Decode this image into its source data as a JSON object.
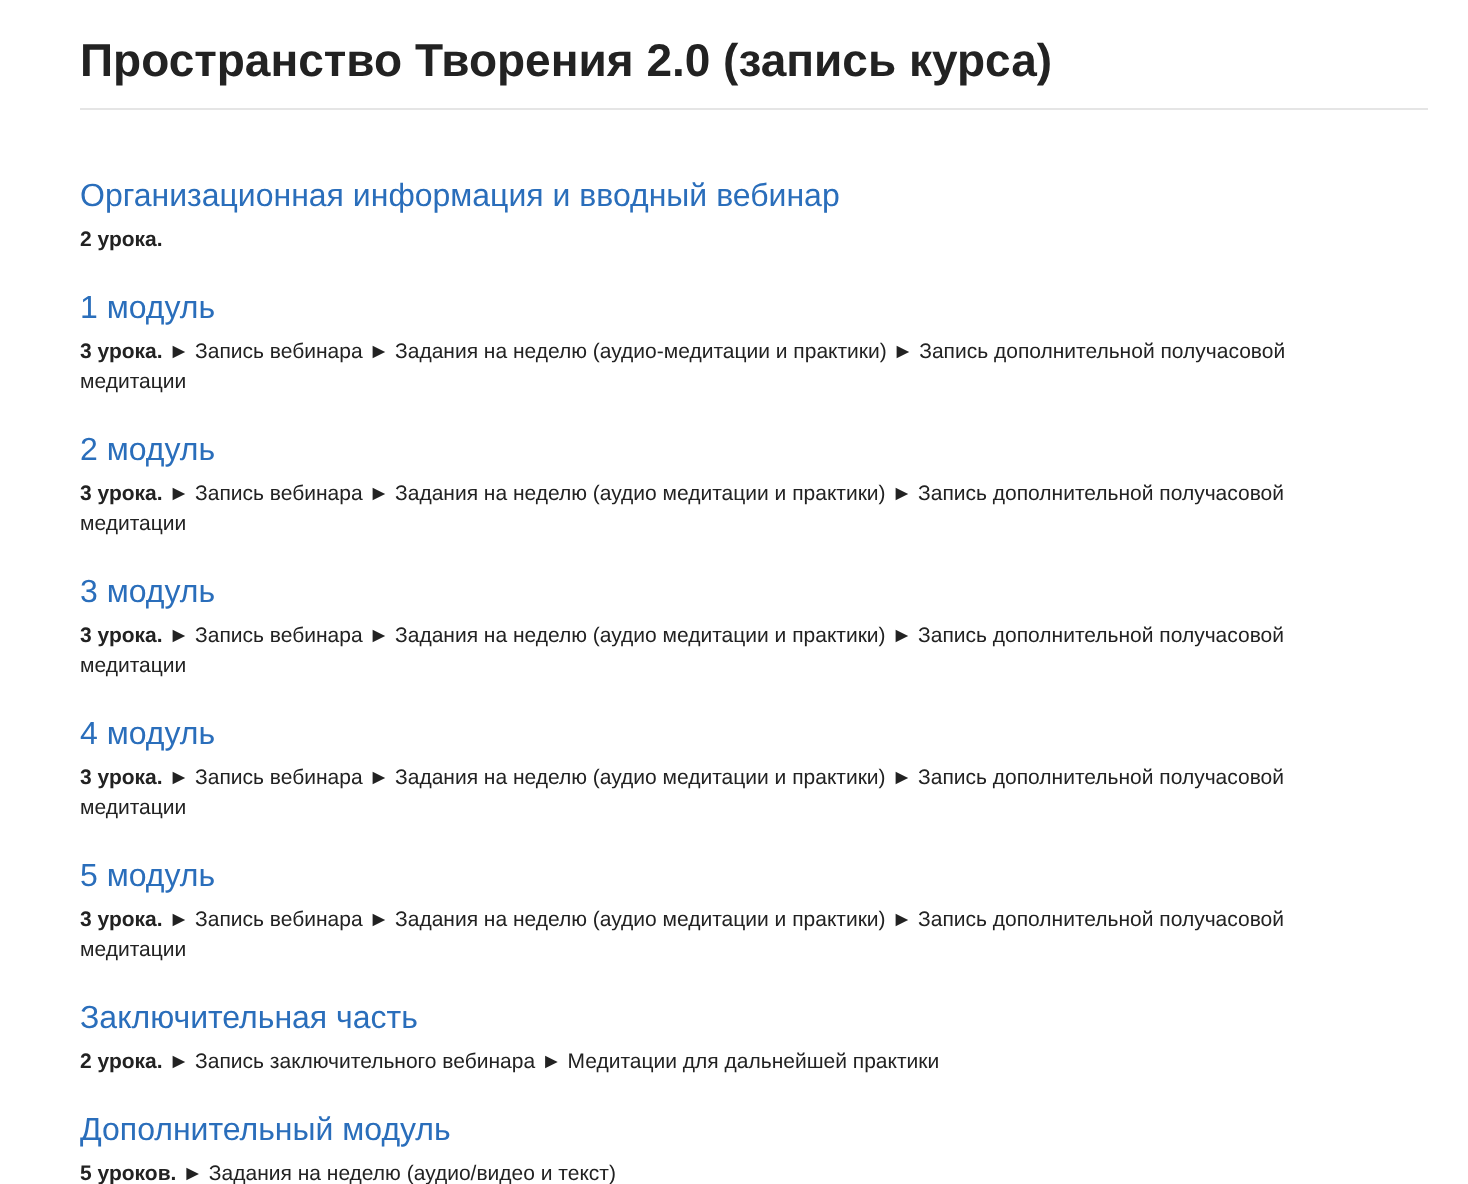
{
  "title": "Пространство Творения 2.0 (запись курса)",
  "modules": [
    {
      "title": "Организационная информация и вводный вебинар",
      "description": "**2 урока.**"
    },
    {
      "title": "1 модуль",
      "description": "**3 урока.** ► Запись вебинара ► Задания на неделю (аудио-медитации и практики) ► Запись дополнительной получасовой медитации"
    },
    {
      "title": "2 модуль",
      "description": "**3 урока.** ► Запись вебинара ► Задания на неделю (аудио медитации и практики) ► Запись дополнительной получасовой медитации"
    },
    {
      "title": "3 модуль",
      "description": "**3 урока.** ► Запись вебинара ► Задания на неделю (аудио медитации и практики) ► Запись дополнительной получасовой медитации"
    },
    {
      "title": "4 модуль",
      "description": "**3 урока.** ► Запись вебинара ► Задания на неделю (аудио медитации и практики) ► Запись дополнительной получасовой медитации"
    },
    {
      "title": "5 модуль",
      "description": "**3 урока.** ► Запись вебинара ► Задания на неделю (аудио медитации и практики) ► Запись дополнительной получасовой медитации"
    },
    {
      "title": "Заключительная часть",
      "description": "**2 урока.** ► Запись заключительного вебинара ► Медитации для дальнейшей практики"
    },
    {
      "title": "Дополнительный модуль",
      "description": "**5 уроков.** ► Задания на неделю (аудио/видео и текст)"
    }
  ]
}
